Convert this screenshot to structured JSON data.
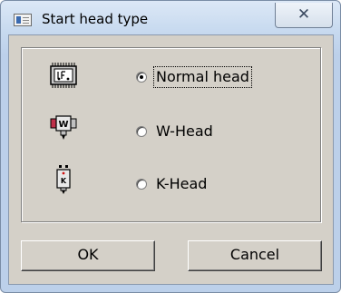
{
  "window": {
    "title": "Start head type",
    "close_glyph": "✕"
  },
  "options": [
    {
      "label": "Normal head",
      "icon": "normal-head-icon",
      "selected": true
    },
    {
      "label": "W-Head",
      "icon": "w-head-icon",
      "selected": false
    },
    {
      "label": "K-Head",
      "icon": "k-head-icon",
      "selected": false
    }
  ],
  "buttons": {
    "ok": "OK",
    "cancel": "Cancel"
  },
  "colors": {
    "dialog_bg": "#d4d0c8",
    "titlebar": "#c9dbf0",
    "w_head_accent": "#c0304a",
    "k_head_accent": "#d01010"
  }
}
